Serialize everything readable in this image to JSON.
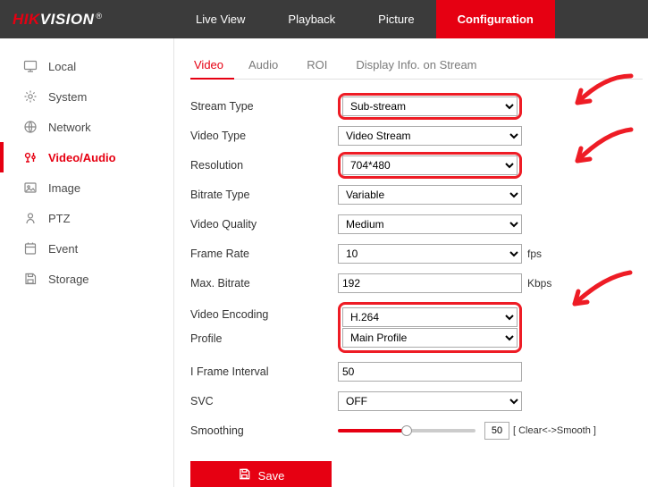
{
  "brand": {
    "part1": "HIK",
    "part2": "VISION",
    "reg": "®"
  },
  "topnav": {
    "items": [
      {
        "label": "Live View"
      },
      {
        "label": "Playback"
      },
      {
        "label": "Picture"
      },
      {
        "label": "Configuration",
        "active": true
      }
    ]
  },
  "sidebar": {
    "items": [
      {
        "label": "Local",
        "icon": "monitor-icon"
      },
      {
        "label": "System",
        "icon": "gear-icon"
      },
      {
        "label": "Network",
        "icon": "globe-icon"
      },
      {
        "label": "Video/Audio",
        "icon": "mic-icon",
        "active": true
      },
      {
        "label": "Image",
        "icon": "image-icon"
      },
      {
        "label": "PTZ",
        "icon": "ptz-icon"
      },
      {
        "label": "Event",
        "icon": "event-icon"
      },
      {
        "label": "Storage",
        "icon": "save-icon"
      }
    ]
  },
  "subtabs": {
    "items": [
      {
        "label": "Video",
        "active": true
      },
      {
        "label": "Audio"
      },
      {
        "label": "ROI"
      },
      {
        "label": "Display Info. on Stream"
      }
    ]
  },
  "form": {
    "stream_type": {
      "label": "Stream Type",
      "value": "Sub-stream"
    },
    "video_type": {
      "label": "Video Type",
      "value": "Video Stream"
    },
    "resolution": {
      "label": "Resolution",
      "value": "704*480"
    },
    "bitrate_type": {
      "label": "Bitrate Type",
      "value": "Variable"
    },
    "video_quality": {
      "label": "Video Quality",
      "value": "Medium"
    },
    "frame_rate": {
      "label": "Frame Rate",
      "value": "10",
      "unit": "fps"
    },
    "max_bitrate": {
      "label": "Max. Bitrate",
      "value": "192",
      "unit": "Kbps"
    },
    "video_encoding": {
      "label": "Video Encoding",
      "value": "H.264"
    },
    "profile": {
      "label": "Profile",
      "value": "Main Profile"
    },
    "i_frame": {
      "label": "I Frame Interval",
      "value": "50"
    },
    "svc": {
      "label": "SVC",
      "value": "OFF"
    },
    "smoothing": {
      "label": "Smoothing",
      "value": "50",
      "range": "[ Clear<->Smooth ]"
    }
  },
  "buttons": {
    "save": "Save"
  },
  "colors": {
    "accent": "#e60012",
    "header": "#3b3b3b",
    "highlight": "#ee1c25"
  }
}
